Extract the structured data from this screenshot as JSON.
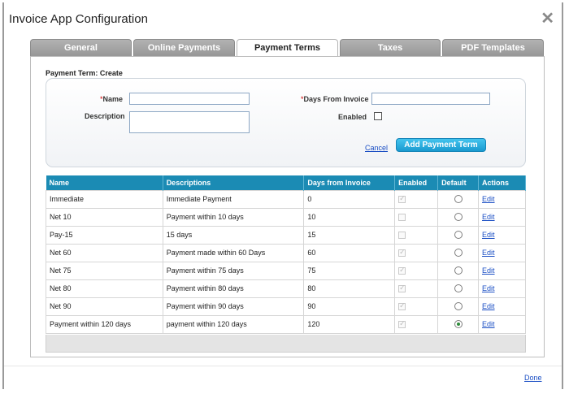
{
  "dialog": {
    "title": "Invoice App Configuration",
    "close_icon": "close-icon",
    "done_label": "Done"
  },
  "tabs": [
    {
      "label": "General",
      "active": false
    },
    {
      "label": "Online Payments",
      "active": false
    },
    {
      "label": "Payment Terms",
      "active": true
    },
    {
      "label": "Taxes",
      "active": false
    },
    {
      "label": "PDF Templates",
      "active": false
    }
  ],
  "form": {
    "section_title": "Payment Term: Create",
    "name_required_mark": "*",
    "name_label": "Name",
    "name_value": "",
    "description_label": "Description",
    "description_value": "",
    "days_required_mark": "*",
    "days_label": "Days From Invoice",
    "days_value": "",
    "enabled_label": "Enabled",
    "enabled_checked": false,
    "cancel_label": "Cancel",
    "add_label": "Add Payment Term"
  },
  "table": {
    "headers": [
      "Name",
      "Descriptions",
      "Days from Invoice",
      "Enabled",
      "Default",
      "Actions"
    ],
    "rows": [
      {
        "name": "Immediate",
        "description": "Immediate Payment",
        "days": "0",
        "enabled": true,
        "default": false,
        "action": "Edit"
      },
      {
        "name": "Net 10",
        "description": "Payment within 10 days",
        "days": "10",
        "enabled": false,
        "default": false,
        "action": "Edit"
      },
      {
        "name": "Pay-15",
        "description": "15 days",
        "days": "15",
        "enabled": false,
        "default": false,
        "action": "Edit"
      },
      {
        "name": "Net 60",
        "description": "Payment made within 60 Days",
        "days": "60",
        "enabled": true,
        "default": false,
        "action": "Edit"
      },
      {
        "name": "Net 75",
        "description": "Payment within 75 days",
        "days": "75",
        "enabled": true,
        "default": false,
        "action": "Edit"
      },
      {
        "name": "Net 80",
        "description": "Payment within 80 days",
        "days": "80",
        "enabled": true,
        "default": false,
        "action": "Edit"
      },
      {
        "name": "Net 90",
        "description": "Payment within 90 days",
        "days": "90",
        "enabled": true,
        "default": false,
        "action": "Edit"
      },
      {
        "name": "Payment within 120 days",
        "description": "payment within 120 days",
        "days": "120",
        "enabled": true,
        "default": true,
        "action": "Edit"
      }
    ]
  },
  "colors": {
    "header_bg": "#1b8bb4",
    "button_bg": "#1a9ad0",
    "tab_inactive": "#a4a4a4",
    "link": "#1a4ec4",
    "radio_selected": "#2e8b3a"
  }
}
